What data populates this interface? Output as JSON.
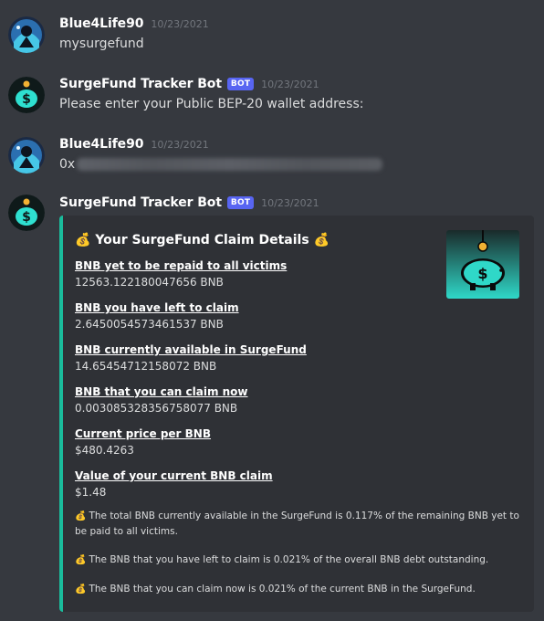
{
  "messages": [
    {
      "author": "Blue4Life90",
      "timestamp": "10/23/2021",
      "text": "mysurgefund"
    },
    {
      "author": "SurgeFund Tracker Bot",
      "bot_tag": "BOT",
      "timestamp": "10/23/2021",
      "text": "Please enter your Public BEP-20 wallet address:"
    },
    {
      "author": "Blue4Life90",
      "timestamp": "10/23/2021",
      "text_prefix": "0x"
    },
    {
      "author": "SurgeFund Tracker Bot",
      "bot_tag": "BOT",
      "timestamp": "10/23/2021"
    }
  ],
  "embed": {
    "title": "Your SurgeFund Claim Details",
    "title_emoji": "💰",
    "accent_color": "#1abc9c",
    "fields": [
      {
        "name": "BNB yet to be repaid to all victims",
        "value": "12563.12218004765​6 BNB"
      },
      {
        "name": "BNB you have left to claim",
        "value": "2.6450054573461537 BNB"
      },
      {
        "name": "BNB currently available in SurgeFund",
        "value": "14.65454712158072 BNB"
      },
      {
        "name": "BNB that you can claim now",
        "value": "0.003085328356758077 BNB"
      },
      {
        "name": "Current price per BNB",
        "value": "$480.4263"
      },
      {
        "name": "Value of your current BNB claim",
        "value": "$1.48"
      }
    ],
    "notes": [
      "The total BNB currently available in the SurgeFund is 0.117% of the remaining BNB yet to be paid to all victims.",
      "The BNB that you have left to claim is 0.021% of the overall BNB debt outstanding.",
      "The BNB that you can claim now is 0.021% of the current BNB in the SurgeFund."
    ],
    "note_emoji": "💰"
  },
  "colors": {
    "background": "#36393f",
    "embed_background": "#2f3136",
    "bot_tag": "#5865f2",
    "accent": "#1abc9c"
  },
  "icons": [
    "user-avatar",
    "bot-avatar",
    "piggy-bank-thumbnail",
    "money-bag-emoji"
  ]
}
